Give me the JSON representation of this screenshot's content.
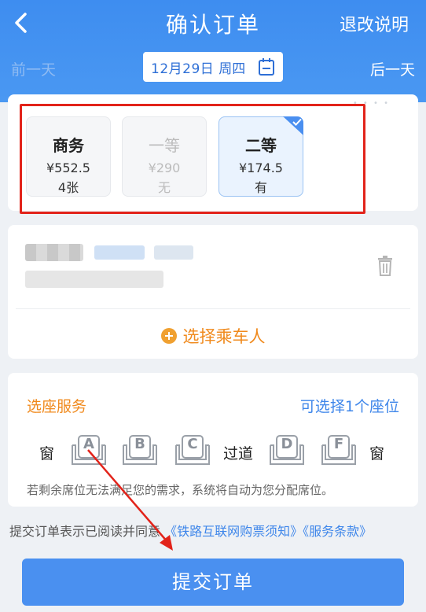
{
  "header": {
    "title": "确认订单",
    "refund_link": "退改说明",
    "prev_day": "前一天",
    "next_day": "后一天",
    "date": "12月29日",
    "weekday": "周四"
  },
  "seat_types": [
    {
      "name": "商务",
      "price": "¥552.5",
      "count": "4张",
      "state": "available"
    },
    {
      "name": "一等",
      "price": "¥290",
      "count": "无",
      "state": "disabled"
    },
    {
      "name": "二等",
      "price": "¥174.5",
      "count": "有",
      "state": "selected"
    }
  ],
  "passenger": {
    "add_label": "选择乘车人"
  },
  "seat_service": {
    "title": "选座服务",
    "hint": "可选择1个座位",
    "window_label": "窗",
    "aisle_label": "过道",
    "seats": [
      "A",
      "B",
      "C",
      "D",
      "F"
    ],
    "note": "若剩余席位无法满足您的需求，系统将自动为您分配席位。"
  },
  "agreement": {
    "prefix": "提交订单表示已阅读并同意",
    "link1": "《铁路互联网购票须知》",
    "link2": "《服务条款》"
  },
  "submit": {
    "label": "提交订单"
  },
  "colors": {
    "primary": "#4a90f0",
    "accent_orange": "#f08a1d",
    "highlight_red": "#e2231a"
  }
}
